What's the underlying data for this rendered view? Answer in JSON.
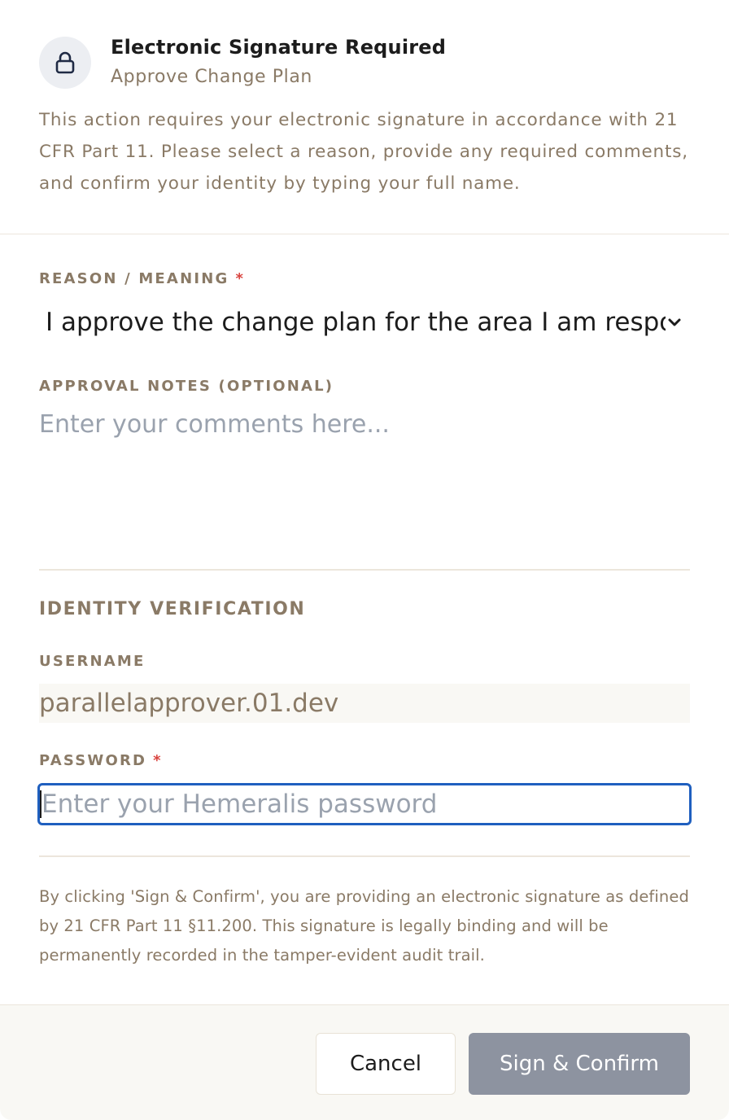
{
  "dialog": {
    "title": "Electronic Signature Required",
    "subtitle": "Approve Change Plan",
    "intro": "This action requires your electronic signature in accordance with 21 CFR Part 11. Please select a reason, provide any required comments, and confirm your identity by typing your full name."
  },
  "reason": {
    "label": "REASON / MEANING",
    "required_mark": "*",
    "selected": "I approve the change plan for the area I am respons"
  },
  "notes": {
    "label": "APPROVAL NOTES (OPTIONAL)",
    "placeholder": "Enter your comments here..."
  },
  "identity": {
    "section_title": "IDENTITY VERIFICATION",
    "username_label": "USERNAME",
    "username_value": "parallelapprover.01.dev",
    "password_label": "PASSWORD",
    "required_mark": "*",
    "password_placeholder": "Enter your Hemeralis password"
  },
  "legal_text": "By clicking 'Sign & Confirm', you are providing an electronic signature as defined by 21 CFR Part 11 §11.200. This signature is legally binding and will be permanently recorded in the tamper-evident audit trail.",
  "buttons": {
    "cancel": "Cancel",
    "sign": "Sign & Confirm"
  },
  "icons": {
    "lock": "lock-icon",
    "chevron": "chevron-down-icon"
  },
  "colors": {
    "accent_focus": "#1f5fbf",
    "required": "#d9443f",
    "muted_text": "#8a7a66",
    "sign_button_disabled": "#8d93a0"
  }
}
